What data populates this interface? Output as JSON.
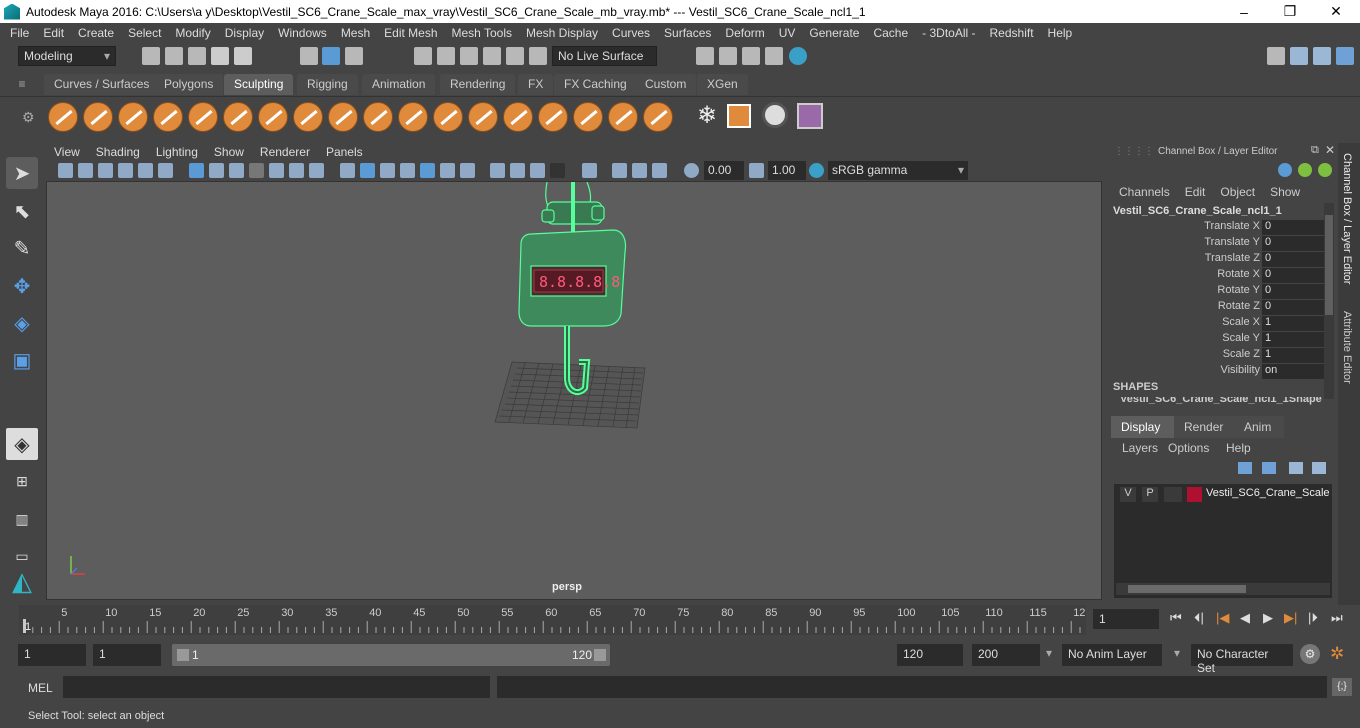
{
  "window": {
    "title": "Autodesk Maya 2016: C:\\Users\\a y\\Desktop\\Vestil_SC6_Crane_Scale_max_vray\\Vestil_SC6_Crane_Scale_mb_vray.mb*   ---   Vestil_SC6_Crane_Scale_ncl1_1",
    "minimize": "–",
    "maximize": "❐",
    "close": "✕"
  },
  "menu": [
    "File",
    "Edit",
    "Create",
    "Select",
    "Modify",
    "Display",
    "Windows",
    "Mesh",
    "Edit Mesh",
    "Mesh Tools",
    "Mesh Display",
    "Curves",
    "Surfaces",
    "Deform",
    "UV",
    "Generate",
    "Cache",
    "- 3DtoAll -",
    "Redshift",
    "Help"
  ],
  "status_line": {
    "mode": "Modeling",
    "live_surface": "No Live Surface"
  },
  "shelf_tabs": [
    "Curves / Surfaces",
    "Polygons",
    "Sculpting",
    "Rigging",
    "Animation",
    "Rendering",
    "FX",
    "FX Caching",
    "Custom",
    "XGen"
  ],
  "active_shelf_tab": "Sculpting",
  "viewport": {
    "menu": [
      "View",
      "Shading",
      "Lighting",
      "Show",
      "Renderer",
      "Panels"
    ],
    "exposure": "0.00",
    "gamma": "1.00",
    "color_space": "sRGB gamma",
    "camera_label": "persp",
    "display_digits": "8.8.8.8.8",
    "wire_color": "#55ff99",
    "background": "#5d5d5d"
  },
  "channel_box": {
    "header": "Channel Box / Layer Editor",
    "menu": [
      "Channels",
      "Edit",
      "Object",
      "Show"
    ],
    "object_name": "Vestil_SC6_Crane_Scale_ncl1_1",
    "attributes": [
      {
        "name": "Translate X",
        "value": "0"
      },
      {
        "name": "Translate Y",
        "value": "0"
      },
      {
        "name": "Translate Z",
        "value": "0"
      },
      {
        "name": "Rotate X",
        "value": "0"
      },
      {
        "name": "Rotate Y",
        "value": "0"
      },
      {
        "name": "Rotate Z",
        "value": "0"
      },
      {
        "name": "Scale X",
        "value": "1"
      },
      {
        "name": "Scale Y",
        "value": "1"
      },
      {
        "name": "Scale Z",
        "value": "1"
      },
      {
        "name": "Visibility",
        "value": "on"
      }
    ],
    "shapes_label": "SHAPES",
    "shape_name": "Vestil_SC6_Crane_Scale_ncl1_1Shape"
  },
  "layer_editor": {
    "tabs": [
      "Display",
      "Render",
      "Anim"
    ],
    "menu": [
      "Layers",
      "Options",
      "Help"
    ],
    "layer": {
      "v": "V",
      "p": "P",
      "name": "Vestil_SC6_Crane_Scale",
      "color": "#b01030"
    }
  },
  "side_tabs": {
    "channel": "Channel Box / Layer Editor",
    "attribute": "Attribute Editor"
  },
  "timeline": {
    "ticks": [
      "5",
      "10",
      "15",
      "20",
      "25",
      "30",
      "35",
      "40",
      "45",
      "50",
      "55",
      "60",
      "65",
      "70",
      "75",
      "80",
      "85",
      "90",
      "95",
      "100",
      "105",
      "110",
      "115",
      "12"
    ],
    "start_marker": "1",
    "current_frame": "1"
  },
  "range": {
    "start": "1",
    "playback_start": "1",
    "slider_start": "1",
    "slider_end": "120",
    "playback_end": "120",
    "end": "200",
    "anim_layer": "No Anim Layer",
    "character_set": "No Character Set"
  },
  "command": {
    "label": "MEL"
  },
  "help_line": "Select Tool: select an object"
}
